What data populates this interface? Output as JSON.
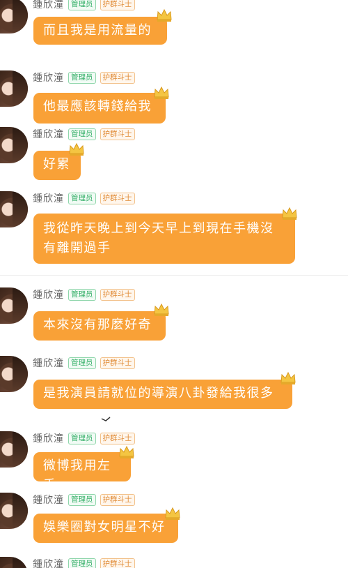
{
  "badges": {
    "admin": "管理员",
    "guard": "护群斗士"
  },
  "messages": [
    {
      "sender": "鍾欣潼",
      "text": "而且我是用流量的"
    },
    {
      "sender": "鍾欣潼",
      "text": "他最應該轉錢給我"
    },
    {
      "sender": "鍾欣潼",
      "text": "好累"
    },
    {
      "sender": "鍾欣潼",
      "text": "我從昨天晚上到今天早上到現在手機沒有離開過手"
    },
    {
      "sender": "鍾欣潼",
      "text": "本來沒有那麼好奇"
    },
    {
      "sender": "鍾欣潼",
      "text": "是我演員請就位的導演八卦發給我很多"
    },
    {
      "sender": "鍾欣潼",
      "text": "微博我用左手"
    },
    {
      "sender": "鍾欣潼",
      "text": "娛樂圈對女明星不好"
    },
    {
      "sender": "鍾欣潼",
      "text": ""
    }
  ],
  "colors": {
    "bubble": "#f9a137",
    "admin_badge": "#37b06a",
    "guard_badge": "#e08a34"
  }
}
